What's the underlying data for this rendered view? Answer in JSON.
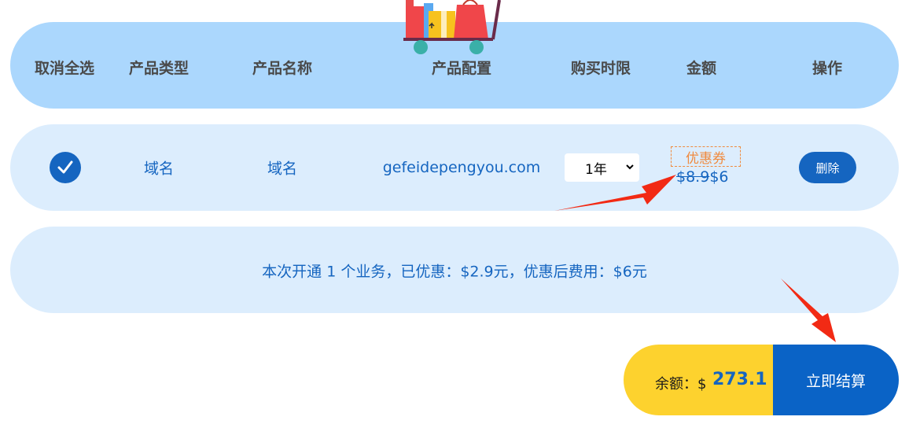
{
  "header": {
    "columns": [
      "取消全选",
      "产品类型",
      "产品名称",
      "产品配置",
      "购买时限",
      "金额",
      "操作"
    ]
  },
  "row": {
    "product_type": "域名",
    "product_name": "域名",
    "config": "gefeidepengyou.com",
    "period": "1年",
    "coupon": "优惠券",
    "old_price": "$8.9",
    "new_price": "$6",
    "delete_label": "删除"
  },
  "summary": {
    "text": "本次开通 1 个业务，已优惠：$2.9元，优惠后费用：$6元"
  },
  "footer": {
    "balance_label": "余额：$",
    "balance_value": "273.1",
    "checkout_label": "立即结算"
  },
  "colors": {
    "header_bg": "#abd7fd",
    "row_bg": "#dcedfd",
    "primary": "#1565c0",
    "balance_bg": "#fdd22e",
    "coupon": "#f08a3e",
    "annotation_arrow": "#f22a14"
  },
  "icons": [
    "shopping-cart-illustration",
    "checkmark-icon",
    "chevron-down-icon",
    "red-arrow-annotation"
  ]
}
